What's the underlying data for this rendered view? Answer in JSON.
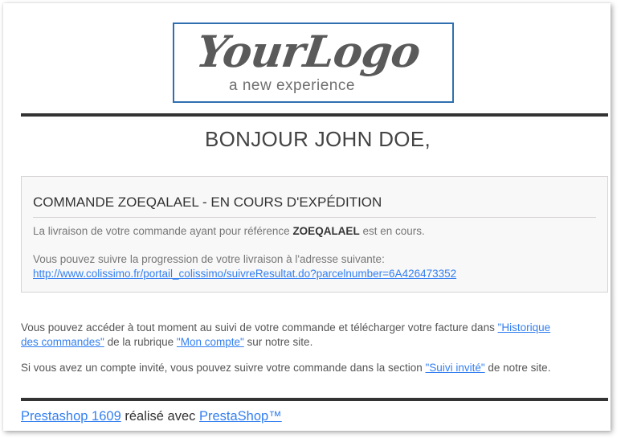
{
  "logo": {
    "script": "YourLogo",
    "tagline": "a new experience"
  },
  "greeting": "BONJOUR JOHN DOE,",
  "panel": {
    "title": "COMMANDE ZOEQALAEL - EN COURS D'EXPÉDITION",
    "line1_before": "La livraison de votre commande ayant pour référence ",
    "line1_ref": "ZOEQALAEL",
    "line1_after": " est en cours.",
    "line2": "Vous pouvez suivre la progression de votre livraison à l'adresse suivante:",
    "tracking_url": "http://www.colissimo.fr/portail_colissimo/suivreResultat.do?parcelnumber=6A426473352"
  },
  "paragraph1": {
    "text_a": "Vous pouvez accéder à tout moment au suivi de votre commande et télécharger votre facture dans ",
    "link_history_1": "\"Historique",
    "link_history_2": "des commandes\"",
    "text_b": " de la rubrique ",
    "link_account": "\"Mon compte\"",
    "text_c": " sur notre site."
  },
  "paragraph2": {
    "text_a": "Si vous avez un compte invité, vous pouvez suivre votre commande dans la section ",
    "link_guest": "\"Suivi invité\"",
    "text_b": " de notre site."
  },
  "footer": {
    "shop_link": "Prestashop 1609",
    "middle": " réalisé avec ",
    "powered_link": "PrestaShop™"
  },
  "colors": {
    "link": "#337ff1",
    "logo_border": "#2f6fb0",
    "rule": "#333333"
  }
}
